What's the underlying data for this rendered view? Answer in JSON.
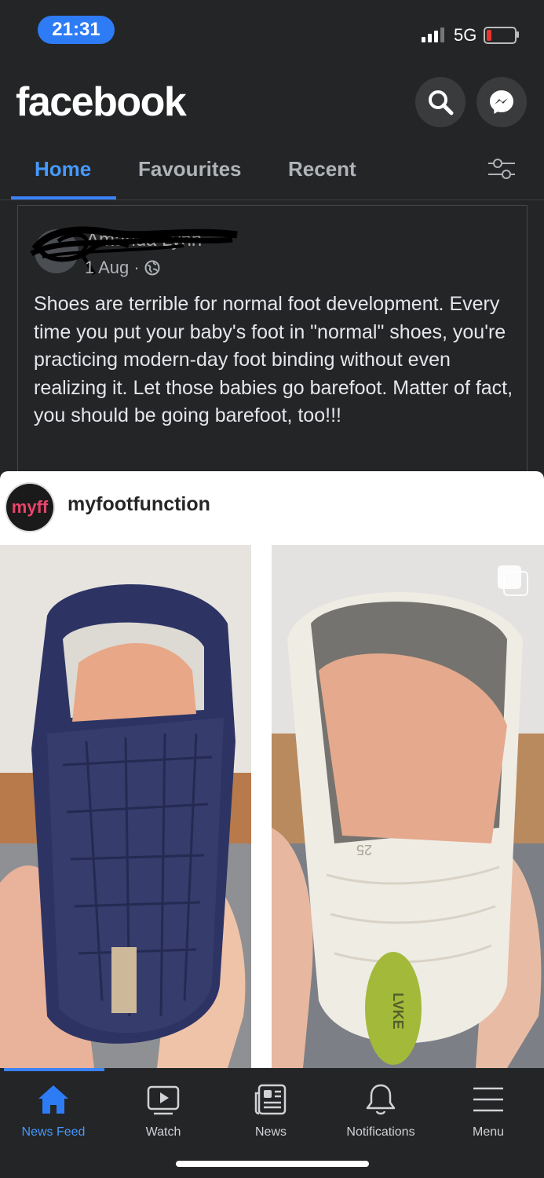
{
  "status_bar": {
    "time": "21:31",
    "network": "5G"
  },
  "header": {
    "logo": "facebook"
  },
  "tabs": [
    {
      "label": "Home"
    },
    {
      "label": "Favourites"
    },
    {
      "label": "Recent"
    }
  ],
  "post": {
    "author": "Amanda Lynn",
    "date": "1 Aug",
    "separator": "·",
    "text": "Shoes are terrible for normal foot development. Every time you put your baby's foot in \"normal\" shoes, you're practicing modern-day foot binding without even realizing it. Let those babies go barefoot. Matter of fact, you should be going barefoot, too!!!"
  },
  "shared": {
    "avatar_text": "myff",
    "account_name": "myfootfunction",
    "shoe_size": "25",
    "shoe_brand": "LVKE"
  },
  "bottom_nav": [
    {
      "label": "News Feed"
    },
    {
      "label": "Watch"
    },
    {
      "label": "News"
    },
    {
      "label": "Notifications"
    },
    {
      "label": "Menu"
    }
  ],
  "colors": {
    "accent": "#4599ff",
    "background": "#242526",
    "battery_low": "#e8352e"
  }
}
